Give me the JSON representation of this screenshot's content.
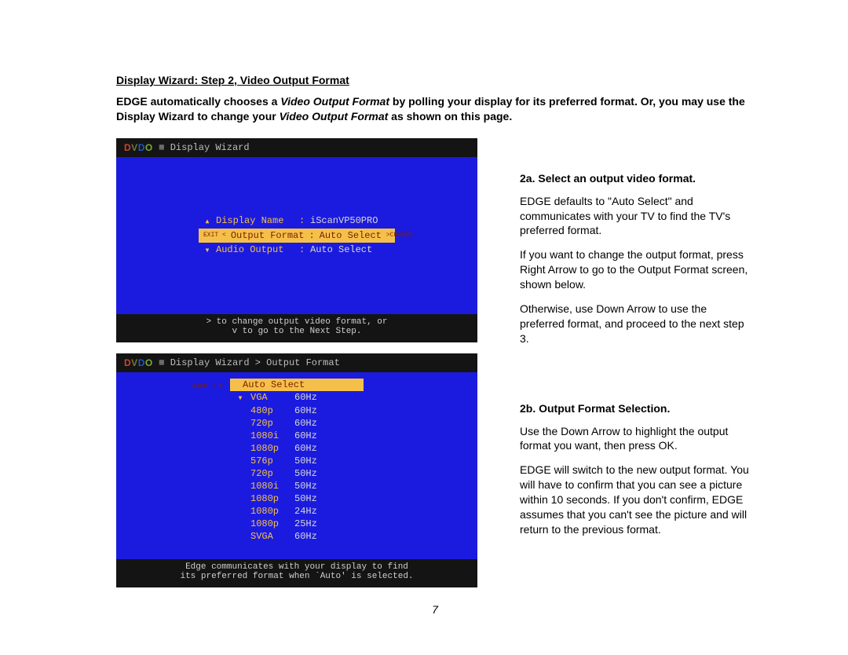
{
  "heading": "Display Wizard:  Step 2, Video Output Format",
  "intro_a": "EDGE automatically chooses a ",
  "intro_b": "Video Output Format",
  "intro_c": " by polling your display for its preferred format.  Or, you may use the Display Wizard to change your ",
  "intro_d": "Video Output Format",
  "intro_e": " as shown on this page.",
  "screen1": {
    "crumb": "Display Wizard",
    "rows": [
      {
        "arrow": "▴",
        "label": "Display Name",
        "value": "iScanVP50PRO",
        "selected": false
      },
      {
        "arrow": "",
        "label": "Output Format",
        "value": "Auto Select",
        "selected": true,
        "exit": "EXIT <",
        "change": ">CHANGE"
      },
      {
        "arrow": "▾",
        "label": "Audio Output",
        "value": "Auto Select",
        "selected": false
      }
    ],
    "foot1": "> to change output video format, or",
    "foot2": "v to go to the Next Step."
  },
  "screen2": {
    "crumb": "Display Wizard > Output Format",
    "back": "BACK < ⊛",
    "items": [
      {
        "a": "",
        "name": "Auto Select",
        "hz": "",
        "selected": true
      },
      {
        "a": "▾",
        "name": "VGA",
        "hz": "60Hz",
        "selected": false
      },
      {
        "a": "",
        "name": "480p",
        "hz": "60Hz",
        "selected": false
      },
      {
        "a": "",
        "name": "720p",
        "hz": "60Hz",
        "selected": false
      },
      {
        "a": "",
        "name": "1080i",
        "hz": "60Hz",
        "selected": false
      },
      {
        "a": "",
        "name": "1080p",
        "hz": "60Hz",
        "selected": false
      },
      {
        "a": "",
        "name": "576p",
        "hz": "50Hz",
        "selected": false
      },
      {
        "a": "",
        "name": "720p",
        "hz": "50Hz",
        "selected": false
      },
      {
        "a": "",
        "name": "1080i",
        "hz": "50Hz",
        "selected": false
      },
      {
        "a": "",
        "name": "1080p",
        "hz": "50Hz",
        "selected": false
      },
      {
        "a": "",
        "name": "1080p",
        "hz": "24Hz",
        "selected": false
      },
      {
        "a": "",
        "name": "1080p",
        "hz": "25Hz",
        "selected": false
      },
      {
        "a": "",
        "name": "SVGA",
        "hz": "60Hz",
        "selected": false
      }
    ],
    "foot1": "Edge communicates with your display to find",
    "foot2": "its preferred format when `Auto' is selected."
  },
  "right": {
    "h2a": "2a.  Select an output video format.",
    "p1": "EDGE defaults to \"Auto Select\" and communicates with your TV to find the TV's preferred format.",
    "p2": "If you want to change the output format, press Right Arrow to go to the Output Format screen, shown below.",
    "p3": "Otherwise, use Down Arrow to use the preferred format, and proceed to the next step 3.",
    "h2b": "2b.  Output Format Selection.",
    "p4": "Use the Down Arrow to highlight the output format you want, then press OK.",
    "p5": "EDGE will switch to the new output format.  You will have to confirm that you can see a picture within 10 seconds. If you don't confirm, EDGE assumes that you can't see the picture and will return to the previous format."
  },
  "pagenum": "7"
}
